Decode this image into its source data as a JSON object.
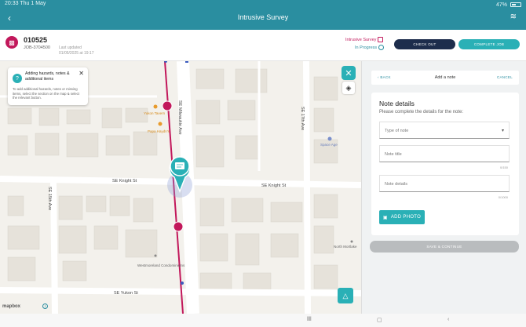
{
  "status": {
    "time": "20:33",
    "date": "Thu 1 May",
    "battery": "47%"
  },
  "header": {
    "title": "Intrusive Survey"
  },
  "job": {
    "number": "010525",
    "reference": "JOB-3704500",
    "last_updated_label": "Last updated",
    "last_updated_value": "01/05/2025 at 19:17",
    "survey_type": "Intrusive Survey",
    "status": "In Progress",
    "check_out_label": "CHECK OUT",
    "complete_label": "COMPLETE JOB"
  },
  "map": {
    "streets": [
      "SE Milwaukie Ave",
      "SE Knight St",
      "SE Knight St",
      "SE 17th Ave",
      "SE 15th Ave",
      "SE Yukon St"
    ],
    "places": [
      "Yukon Tavern",
      "Papa Haydn's",
      "Space Age",
      "Westmoreland Condominiums",
      "North Mortlake"
    ],
    "mapbox_label": "mapbox",
    "tooltip": {
      "title": "Adding hazards, notes & additional items",
      "body": "To add additional hazards, notes or missing items, select the section on the map & select the relevant button."
    }
  },
  "panel": {
    "back_label": "BACK",
    "title": "Add a note",
    "cancel_label": "CANCEL",
    "card_title": "Note details",
    "card_subtitle": "Please complete the details for the note:",
    "type_placeholder": "Type of note",
    "title_placeholder": "Note title",
    "title_counter": "0/150",
    "details_placeholder": "Note details",
    "details_counter": "0/1000",
    "add_photo_label": "ADD PHOTO",
    "save_label": "SAVE & CONTINUE"
  },
  "colors": {
    "header": "#2a8ea0",
    "accent": "#2ab0b6",
    "brand": "#c2185b",
    "dark": "#1d2d4c",
    "route": "#c2185b"
  }
}
